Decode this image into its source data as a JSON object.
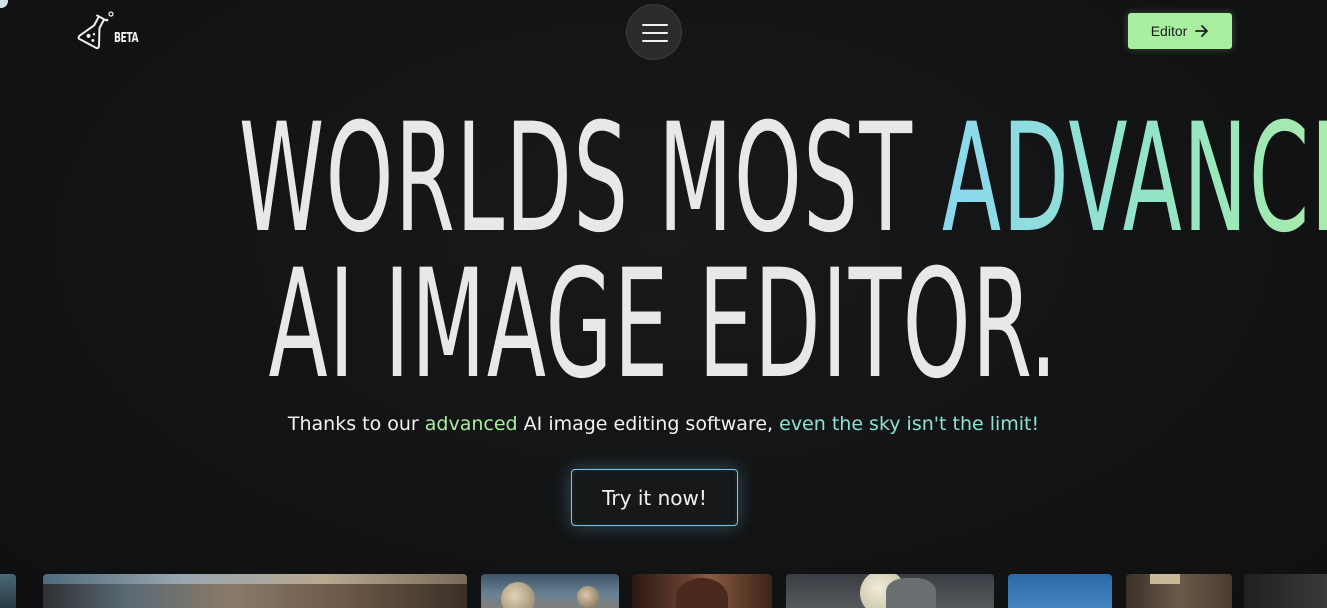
{
  "header": {
    "logo_badge": "BETA",
    "menu_label": "menu",
    "editor_button": "Editor"
  },
  "hero": {
    "line1_plain": "WORLDS MOST",
    "line1_accent": "ADVANCED",
    "line2": "AI IMAGE EDITOR.",
    "subtitle_part1": "Thanks to our",
    "subtitle_accent1": "advanced",
    "subtitle_part2": "AI image editing software,",
    "subtitle_accent2": "even the sky isn't the limit!",
    "cta_label": "Try it now!"
  },
  "colors": {
    "background": "#111213",
    "accent_green": "#a8f0a0",
    "accent_cyan": "#8ad8f0",
    "cta_border": "#78c8e0"
  },
  "icons": {
    "logo": "flask-icon",
    "menu": "hamburger-icon",
    "editor_arrow": "arrow-right-icon"
  }
}
